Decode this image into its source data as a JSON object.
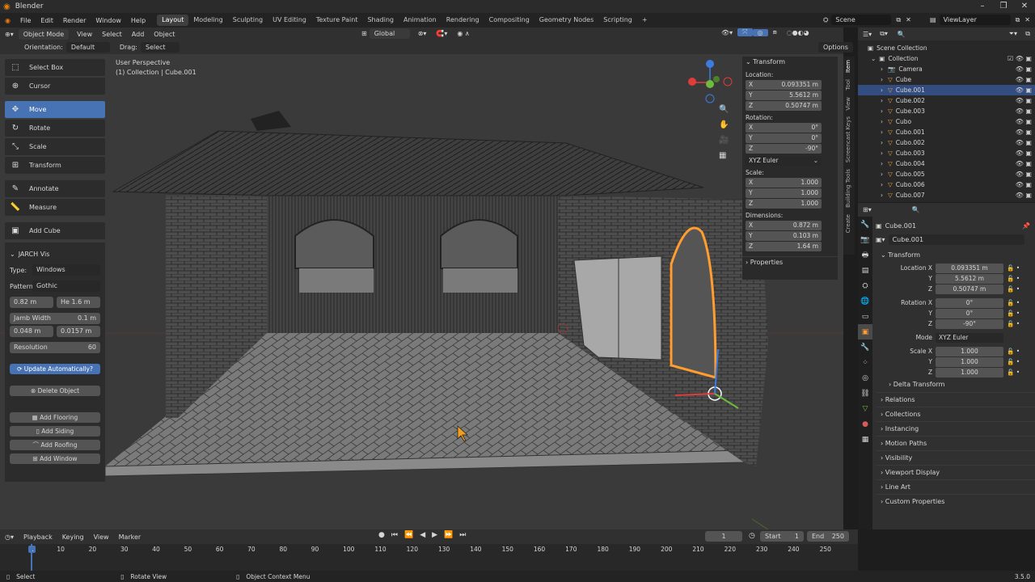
{
  "app": {
    "title": "Blender",
    "version": "3.5.0"
  },
  "menu": [
    "File",
    "Edit",
    "Render",
    "Window",
    "Help"
  ],
  "workspaces": [
    "Layout",
    "Modeling",
    "Sculpting",
    "UV Editing",
    "Texture Paint",
    "Shading",
    "Animation",
    "Rendering",
    "Compositing",
    "Geometry Nodes",
    "Scripting"
  ],
  "active_workspace": "Layout",
  "scene": "Scene",
  "view_layer": "ViewLayer",
  "viewport_header": {
    "mode": "Object Mode",
    "menus": [
      "View",
      "Select",
      "Add",
      "Object"
    ],
    "transform_orientation": "Global",
    "orientation_label": "Orientation:",
    "orientation_value": "Default",
    "drag_label": "Drag:",
    "drag_value": "Select Box",
    "options": "Options"
  },
  "viewport_info": {
    "line1": "User Perspective",
    "line2": "(1) Collection | Cube.001"
  },
  "tools": [
    "Select Box",
    "Cursor",
    "Move",
    "Rotate",
    "Scale",
    "Transform",
    "Annotate",
    "Measure",
    "Add Cube"
  ],
  "active_tool": "Move",
  "jarch": {
    "header": "JARCH Vis",
    "type_label": "Type:",
    "type_value": "Windows",
    "pattern_label": "Pattern:",
    "pattern_value": "Gothic",
    "width": "0.82 m",
    "height_label": "He",
    "height": "1.6 m",
    "jamb_label": "Jamb Width",
    "jamb_value": "0.1 m",
    "jamb2a": "0.048 m",
    "jamb2b": "0.0157 m",
    "resolution_label": "Resolution",
    "resolution_value": "60",
    "update_btn": "Update Automatically?",
    "delete_btn": "Delete Object",
    "buttons": [
      "Add Flooring",
      "Add Siding",
      "Add Roofing",
      "Add Window"
    ]
  },
  "npanel": {
    "transform": "Transform",
    "location_label": "Location:",
    "location": [
      {
        "ax": "X",
        "v": "0.093351 m"
      },
      {
        "ax": "Y",
        "v": "5.5612 m"
      },
      {
        "ax": "Z",
        "v": "0.50747 m"
      }
    ],
    "rotation_label": "Rotation:",
    "rotation": [
      {
        "ax": "X",
        "v": "0°"
      },
      {
        "ax": "Y",
        "v": "0°"
      },
      {
        "ax": "Z",
        "v": "-90°"
      }
    ],
    "rotation_mode": "XYZ Euler",
    "scale_label": "Scale:",
    "scale": [
      {
        "ax": "X",
        "v": "1.000"
      },
      {
        "ax": "Y",
        "v": "1.000"
      },
      {
        "ax": "Z",
        "v": "1.000"
      }
    ],
    "dimensions_label": "Dimensions:",
    "dimensions": [
      {
        "ax": "X",
        "v": "0.872 m"
      },
      {
        "ax": "Y",
        "v": "0.103 m"
      },
      {
        "ax": "Z",
        "v": "1.64 m"
      }
    ],
    "properties": "Properties",
    "tabs": [
      "Item",
      "Tool",
      "View",
      "Screencast Keys",
      "Building Tools",
      "Create"
    ]
  },
  "outliner": {
    "root": "Scene Collection",
    "collection": "Collection",
    "items": [
      "Camera",
      "Cube",
      "Cube.001",
      "Cube.002",
      "Cube.003",
      "Cubo",
      "Cubo.001",
      "Cubo.002",
      "Cubo.003",
      "Cubo.004",
      "Cubo.005",
      "Cubo.006",
      "Cubo.007"
    ],
    "selected": "Cube.001"
  },
  "properties": {
    "object_name": "Cube.001",
    "object_field": "Cube.001",
    "transform": "Transform",
    "location": [
      {
        "l": "Location X",
        "v": "0.093351 m"
      },
      {
        "l": "Y",
        "v": "5.5612 m"
      },
      {
        "l": "Z",
        "v": "0.50747 m"
      }
    ],
    "rotation": [
      {
        "l": "Rotation X",
        "v": "0°"
      },
      {
        "l": "Y",
        "v": "0°"
      },
      {
        "l": "Z",
        "v": "-90°"
      }
    ],
    "mode_label": "Mode",
    "mode_value": "XYZ Euler",
    "scale": [
      {
        "l": "Scale X",
        "v": "1.000"
      },
      {
        "l": "Y",
        "v": "1.000"
      },
      {
        "l": "Z",
        "v": "1.000"
      }
    ],
    "delta": "Delta Transform",
    "sections": [
      "Relations",
      "Collections",
      "Instancing",
      "Motion Paths",
      "Visibility",
      "Viewport Display",
      "Line Art",
      "Custom Properties"
    ]
  },
  "timeline": {
    "menus": [
      "Playback",
      "Keying",
      "View",
      "Marker"
    ],
    "current_frame": "1",
    "start_label": "Start",
    "start": "1",
    "end_label": "End",
    "end": "250",
    "ticks": [
      "1",
      "10",
      "20",
      "30",
      "40",
      "50",
      "60",
      "70",
      "80",
      "90",
      "100",
      "110",
      "120",
      "130",
      "140",
      "150",
      "160",
      "170",
      "180",
      "190",
      "200",
      "210",
      "220",
      "230",
      "240",
      "250"
    ]
  },
  "status": {
    "select": "Select",
    "rotate": "Rotate View",
    "context": "Object Context Menu"
  }
}
